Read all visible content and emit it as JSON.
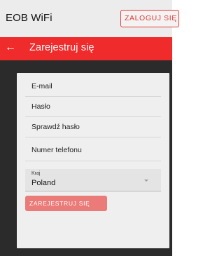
{
  "header": {
    "app_title": "EOB WiFi",
    "login_label": "ZALOGUJ SIĘ"
  },
  "toolbar": {
    "back_icon": "arrow-back",
    "title": "Zarejestruj się"
  },
  "form": {
    "fields": [
      {
        "label": "E-mail"
      },
      {
        "label": "Hasło"
      },
      {
        "label": "Sprawdź hasło"
      },
      {
        "label": "Numer telefonu"
      }
    ],
    "country": {
      "caption": "Kraj",
      "value": "Poland"
    },
    "submit_label": "ZAREJESTRUJ SIĘ"
  },
  "colors": {
    "accent": "#ef2b2b",
    "background_dark": "#2b2b2b",
    "card": "#efefef",
    "disabled_button": "#ea7b79"
  }
}
